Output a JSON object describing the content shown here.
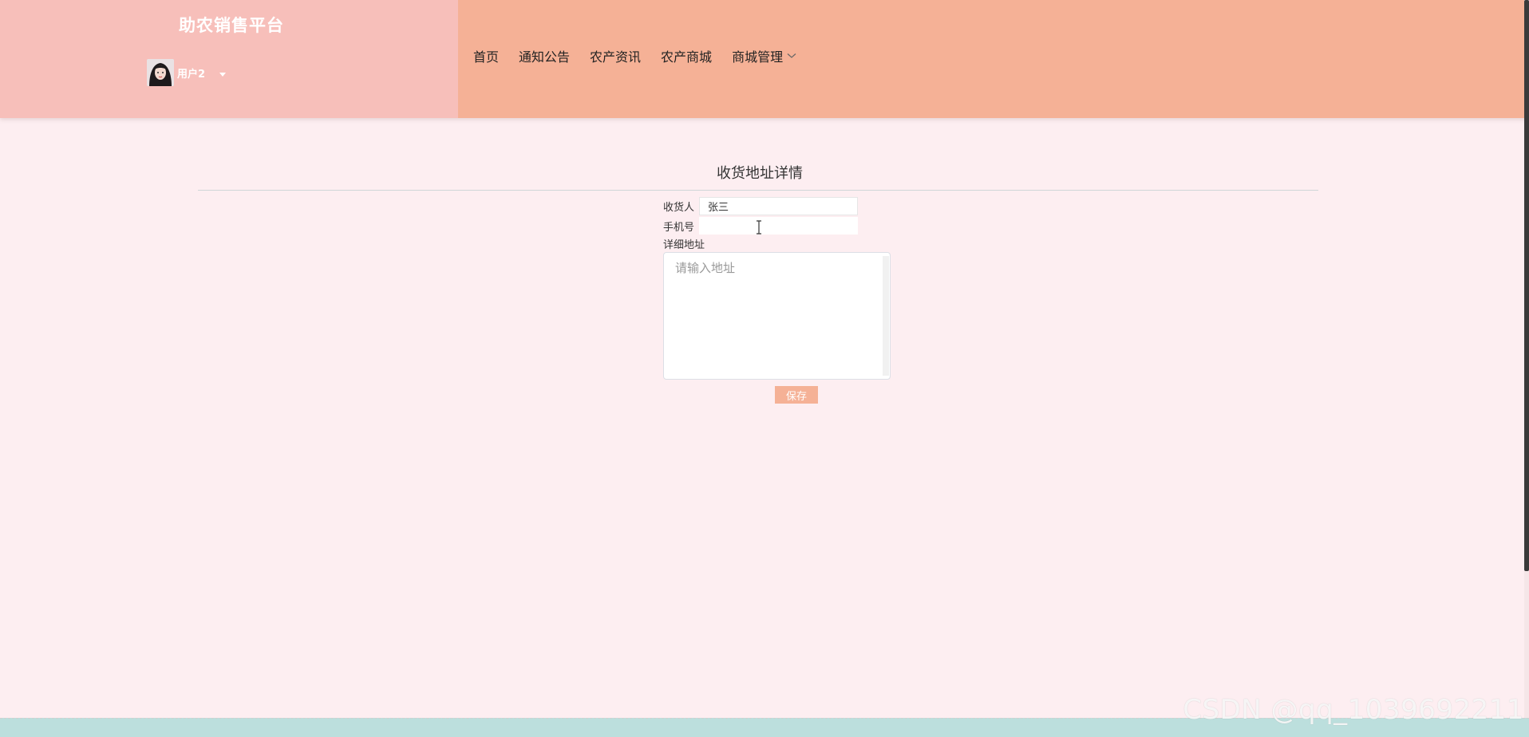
{
  "header": {
    "site_title": "助农销售平台",
    "username": "用户2",
    "nav": [
      {
        "label": "首页"
      },
      {
        "label": "通知公告"
      },
      {
        "label": "农产资讯"
      },
      {
        "label": "农产商城"
      },
      {
        "label": "商城管理",
        "has_dropdown": true
      }
    ]
  },
  "form": {
    "title": "收货地址详情",
    "consignee": {
      "label": "收货人",
      "value": "张三"
    },
    "phone": {
      "label": "手机号",
      "value": ""
    },
    "address": {
      "label": "详细地址",
      "placeholder": "请输入地址",
      "value": ""
    },
    "save_label": "保存"
  },
  "watermark": "CSDN @qq_1039692211",
  "colors": {
    "brand_panel": "#f7bfba",
    "nav_panel": "#f5b196",
    "page_background": "#fdeef1",
    "footer_strip": "#bcdfdd",
    "save_button": "#f5b196"
  }
}
